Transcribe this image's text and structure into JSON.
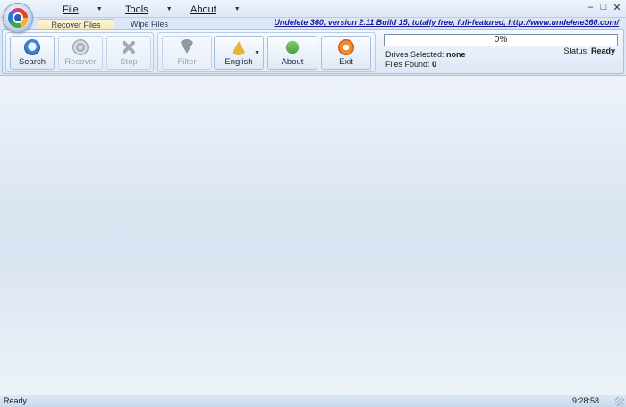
{
  "menu": {
    "file": "File",
    "tools": "Tools",
    "about": "About"
  },
  "window_controls": {
    "minimize": "–",
    "maximize": "□",
    "close": "✕"
  },
  "tabs": [
    {
      "label": "Recover Files",
      "active": true
    },
    {
      "label": "Wipe Files",
      "active": false
    }
  ],
  "banner": "Undelete 360, version 2.11 Build 15, totally free, full-featured, http://www.undelete360.com/",
  "ribbon": {
    "search": "Search",
    "recover": "Recover",
    "stop": "Stop",
    "filter": "Filter",
    "english": "English",
    "about": "About",
    "exit": "Exit"
  },
  "progress": {
    "value": 0,
    "text": "0%"
  },
  "info": {
    "drives_label": "Drives Selected:",
    "drives_value": "none",
    "files_label": "Files Found:",
    "files_value": "0",
    "status_label": "Status:",
    "status_value": "Ready"
  },
  "statusbar": {
    "left": "Ready",
    "time": "9:28:58"
  },
  "icons": [
    "app-logo-icon",
    "search-icon",
    "recover-icon",
    "stop-icon",
    "filter-icon",
    "language-icon",
    "about-icon",
    "exit-icon"
  ]
}
